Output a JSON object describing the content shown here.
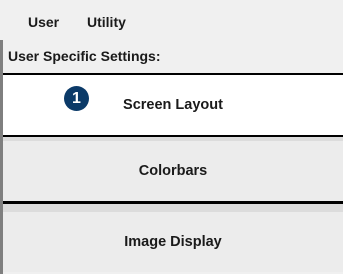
{
  "menubar": {
    "items": [
      "User",
      "Utility"
    ]
  },
  "section": {
    "title": "User Specific Settings:"
  },
  "buttons": [
    {
      "label": "Screen Layout",
      "selected": true
    },
    {
      "label": "Colorbars",
      "selected": false
    },
    {
      "label": "Image Display",
      "selected": false
    }
  ],
  "badge": {
    "number": "1",
    "color": "#0b3a68"
  },
  "colors": {
    "background": "#f0f0f0",
    "selected_bg": "#ffffff",
    "border": "#000000"
  }
}
